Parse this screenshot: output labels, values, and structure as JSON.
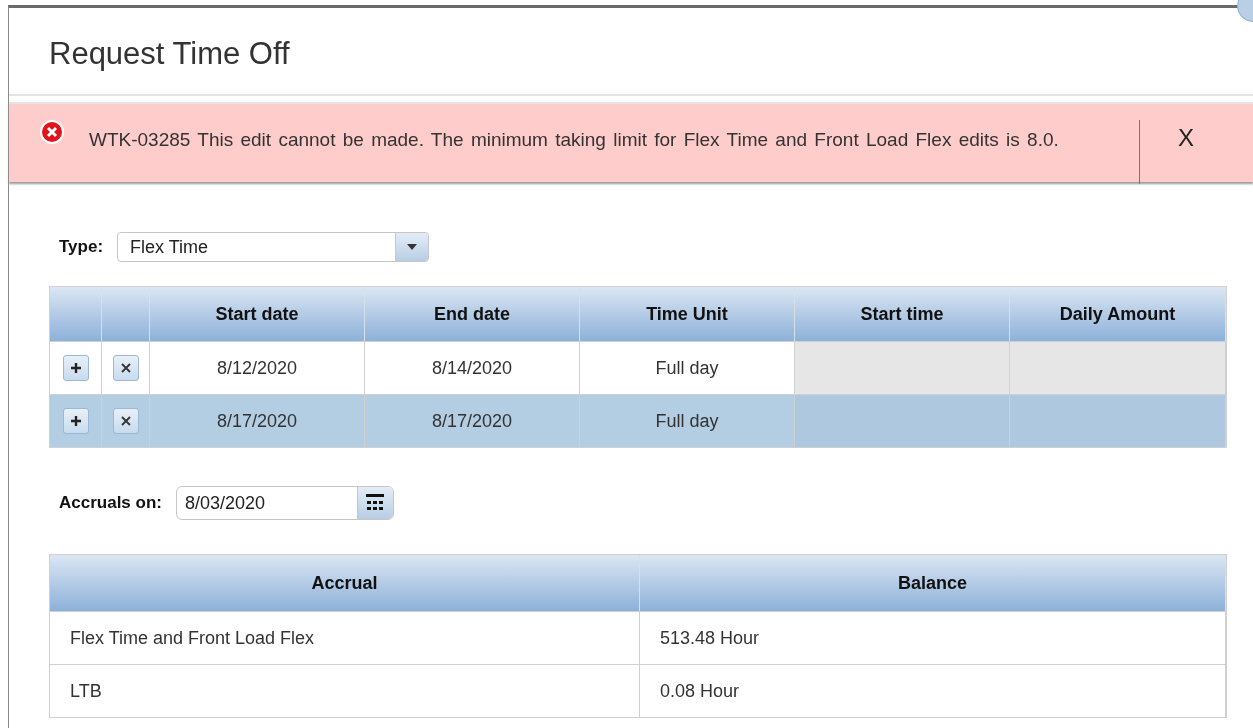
{
  "dialog": {
    "title": "Request Time Off"
  },
  "error": {
    "message": "WTK-03285 This edit cannot be made. The minimum taking limit for Flex Time and Front Load Flex edits is 8.0.",
    "dismiss": "X"
  },
  "type_field": {
    "label": "Type:",
    "value": "Flex Time"
  },
  "requests": {
    "columns": [
      "Start date",
      "End date",
      "Time Unit",
      "Start time",
      "Daily Amount"
    ],
    "rows": [
      {
        "start_date": "8/12/2020",
        "end_date": "8/14/2020",
        "time_unit": "Full day",
        "time_fields_disabled": true,
        "selected": false
      },
      {
        "start_date": "8/17/2020",
        "end_date": "8/17/2020",
        "time_unit": "Full day",
        "time_fields_disabled": true,
        "selected": true
      }
    ]
  },
  "accruals_on": {
    "label": "Accruals on:",
    "value": "8/03/2020"
  },
  "accruals": {
    "columns": [
      "Accrual",
      "Balance"
    ],
    "rows": [
      {
        "accrual": "Flex Time and Front Load Flex",
        "balance": "513.48 Hour"
      },
      {
        "accrual": "LTB",
        "balance": "0.08 Hour"
      }
    ]
  }
}
